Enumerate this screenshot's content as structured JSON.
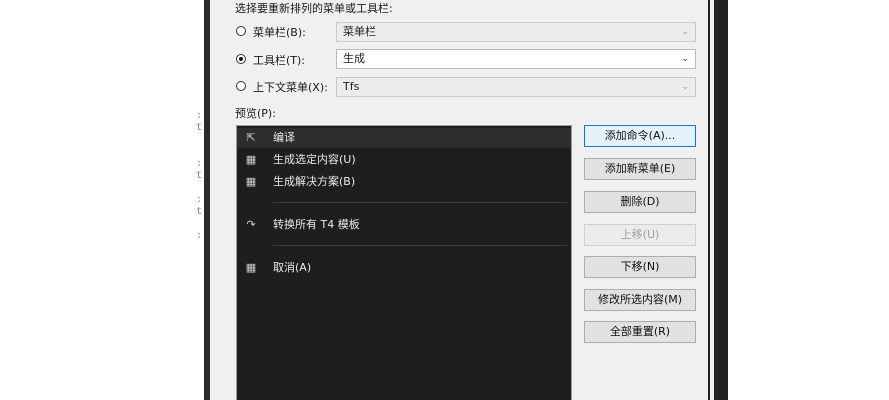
{
  "dialog": {
    "choose_label": "选择要重新排列的菜单或工具栏:",
    "options": [
      {
        "label": "菜单栏(B):",
        "checked": false,
        "value": "菜单栏",
        "enabled": false
      },
      {
        "label": "工具栏(T):",
        "checked": true,
        "value": "生成",
        "enabled": true
      },
      {
        "label": "上下文菜单(X):",
        "checked": false,
        "value": "Tfs",
        "enabled": false
      }
    ],
    "preview_label": "预览(P):",
    "preview_items": [
      {
        "icon": "compile-icon",
        "label": "编译",
        "selected": true
      },
      {
        "icon": "build-selection-icon",
        "label": "生成选定内容(U)",
        "selected": false
      },
      {
        "icon": "build-solution-icon",
        "label": "生成解决方案(B)",
        "selected": false
      },
      {
        "icon": "transform-templates-icon",
        "label": "转换所有 T4 模板",
        "selected": false
      },
      {
        "icon": "cancel-build-icon",
        "label": "取消(A)",
        "selected": false
      }
    ],
    "buttons": [
      {
        "label": "添加命令(A)...",
        "state": "default"
      },
      {
        "label": "添加新菜单(E)",
        "state": "normal"
      },
      {
        "label": "删除(D)",
        "state": "normal"
      },
      {
        "label": "上移(U)",
        "state": "disabled"
      },
      {
        "label": "下移(N)",
        "state": "normal"
      },
      {
        "label": "修改所选内容(M)",
        "state": "normal"
      },
      {
        "label": "全部重置(R)",
        "state": "normal"
      }
    ]
  },
  "colors": {
    "dialog_bg": "#f0f0f0",
    "preview_bg": "#1e1e1e",
    "default_button_border": "#0078d7"
  }
}
